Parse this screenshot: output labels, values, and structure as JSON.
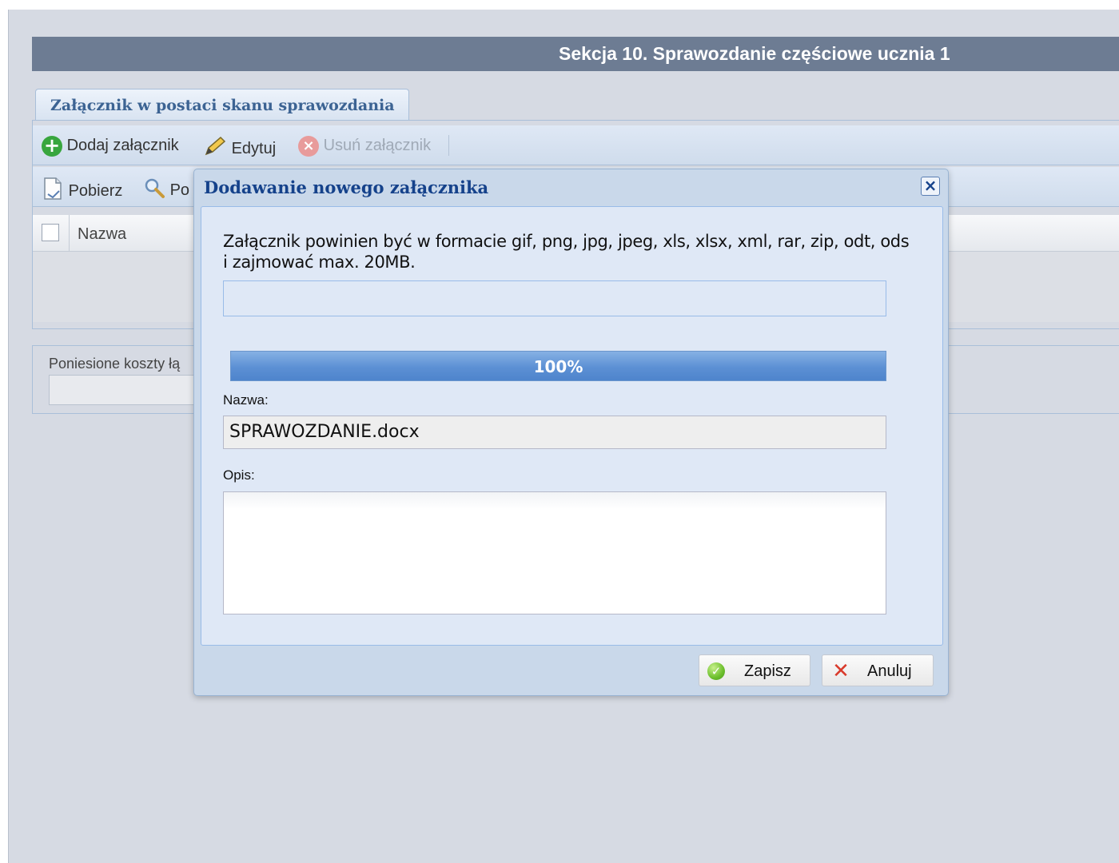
{
  "section": {
    "title": "Sekcja 10. Sprawozdanie częściowe ucznia 1"
  },
  "tab": {
    "label": "Załącznik w postaci skanu sprawozdania"
  },
  "toolbar1": {
    "add_label": "Dodaj załącznik",
    "edit_label": "Edytuj",
    "delete_label": "Usuń załącznik"
  },
  "toolbar2": {
    "download_label": "Pobierz",
    "preview_label": "Po"
  },
  "grid": {
    "column_name": "Nazwa"
  },
  "costs": {
    "label": "Poniesione koszty łą"
  },
  "dialog": {
    "title": "Dodawanie nowego załącznika",
    "info": "Załącznik powinien być w formacie gif, png, jpg, jpeg, xls, xlsx, xml, rar, zip, odt, ods i zajmować max. 20MB.",
    "progress_fraction": 1.0,
    "progress_text": "100%",
    "name_label": "Nazwa:",
    "name_value": "SPRAWOZDANIE.docx",
    "desc_label": "Opis:",
    "desc_value": "",
    "save_label": "Zapisz",
    "cancel_label": "Anuluj"
  },
  "colors": {
    "header_bg": "#6d7c93",
    "tab_text": "#3c6393",
    "dialog_title": "#15428b",
    "progress_fill": "#5c90d4"
  },
  "icons": {
    "add": "plus-circle-icon",
    "edit": "pencil-icon",
    "delete": "delete-circle-icon",
    "download": "document-download-icon",
    "preview": "magnifier-icon",
    "close": "close-icon",
    "save": "check-circle-icon",
    "cancel": "red-x-icon"
  }
}
